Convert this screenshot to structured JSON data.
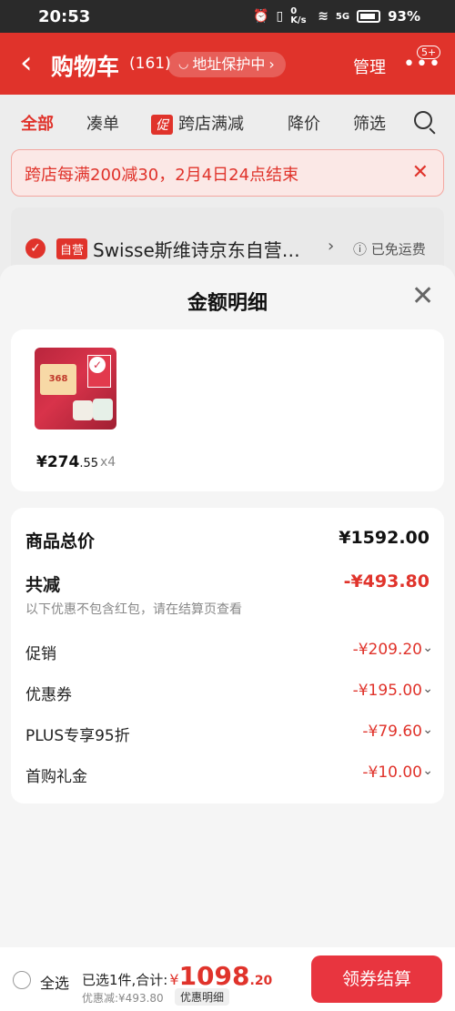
{
  "status_bar": {
    "time": "20:53",
    "battery": "93%",
    "net_speed": "0 K/s",
    "signal": "5G"
  },
  "nav": {
    "title": "购物车",
    "count": "(161)",
    "address_label": "地址保护中",
    "manage_label": "管理",
    "more_badge": "5+"
  },
  "tabs": [
    {
      "label": "全部",
      "active": true
    },
    {
      "label": "凑单"
    },
    {
      "label": "跨店满减",
      "tag": "促"
    },
    {
      "label": "降价"
    },
    {
      "label": "筛选"
    }
  ],
  "banner": {
    "text": "跨店每满200减30，2月4日24点结束"
  },
  "store": {
    "tag": "自营",
    "name": "Swisse斯维诗京东自营…",
    "shipping": "已免运费"
  },
  "sheet": {
    "title": "金额明细",
    "product": {
      "image_badge": "368",
      "price_int": "¥274",
      "price_dec": ".55",
      "qty": "x4"
    },
    "total_label": "商品总价",
    "total_value": "¥1592.00",
    "reduce_label": "共减",
    "reduce_value": "-¥493.80",
    "note": "以下优惠不包含红包，请在结算页查看",
    "items": [
      {
        "label": "促销",
        "value": "-¥209.20"
      },
      {
        "label": "优惠券",
        "value": "-¥195.00"
      },
      {
        "label": "PLUS专享95折",
        "value": "-¥79.60"
      },
      {
        "label": "首购礼金",
        "value": "-¥10.00"
      }
    ]
  },
  "bottom": {
    "select_all": "全选",
    "selected_text": "已选1件,合计:",
    "currency": "¥",
    "sum_int": "1098",
    "sum_dec": ".20",
    "reduced_text": "优惠减:¥493.80",
    "detail_btn": "优惠明细",
    "checkout_btn": "领券结算"
  },
  "colors": {
    "brand_red": "#e0332b",
    "discount_red": "#e0332b"
  }
}
